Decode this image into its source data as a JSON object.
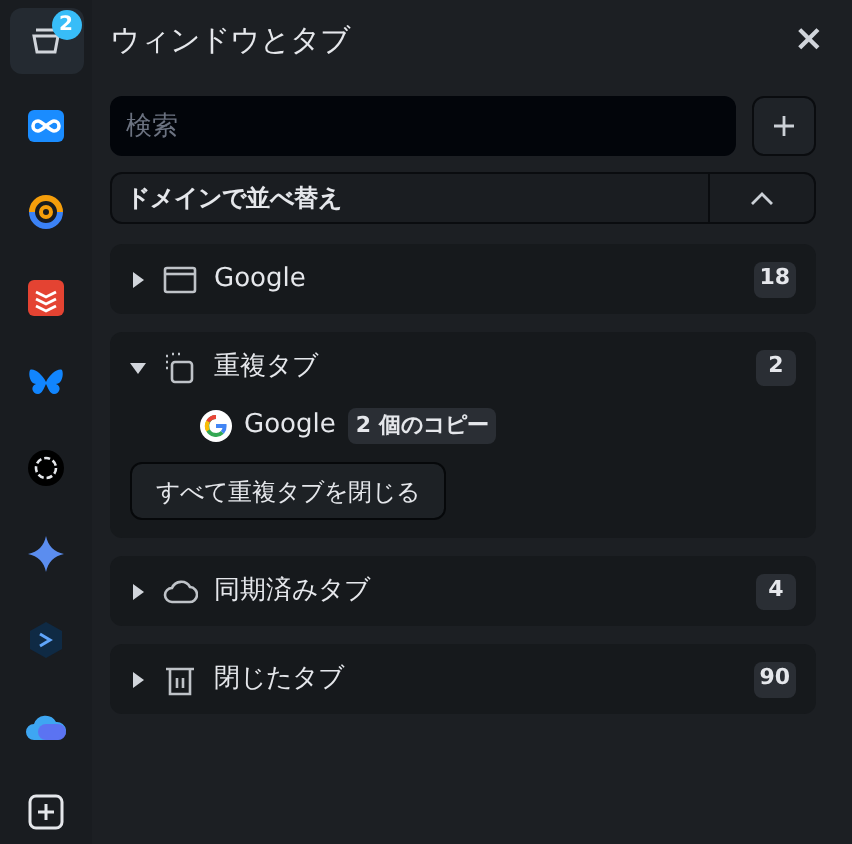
{
  "sidebar": {
    "items": [
      {
        "selected": true,
        "badge": "2"
      },
      {
        "selected": false
      },
      {
        "selected": false
      },
      {
        "selected": false
      },
      {
        "selected": false
      },
      {
        "selected": false
      },
      {
        "selected": false
      },
      {
        "selected": false
      },
      {
        "selected": false
      }
    ],
    "add_button": true
  },
  "panel": {
    "title": "ウィンドウとタブ",
    "close": "×",
    "search": {
      "placeholder": "検索"
    },
    "sort": {
      "label": "ドメインで並べ替え"
    },
    "groups": [
      {
        "kind": "window",
        "title": "Google",
        "count": "18",
        "expanded": false
      },
      {
        "kind": "duplicate",
        "title": "重複タブ",
        "count": "2",
        "expanded": true,
        "tabs": [
          {
            "title": "Google",
            "copies": "2 個のコピー"
          }
        ],
        "action": "すべて重複タブを閉じる"
      },
      {
        "kind": "synced",
        "title": "同期済みタブ",
        "count": "4",
        "expanded": false
      },
      {
        "kind": "closed",
        "title": "閉じたタブ",
        "count": "90",
        "expanded": false
      }
    ]
  }
}
